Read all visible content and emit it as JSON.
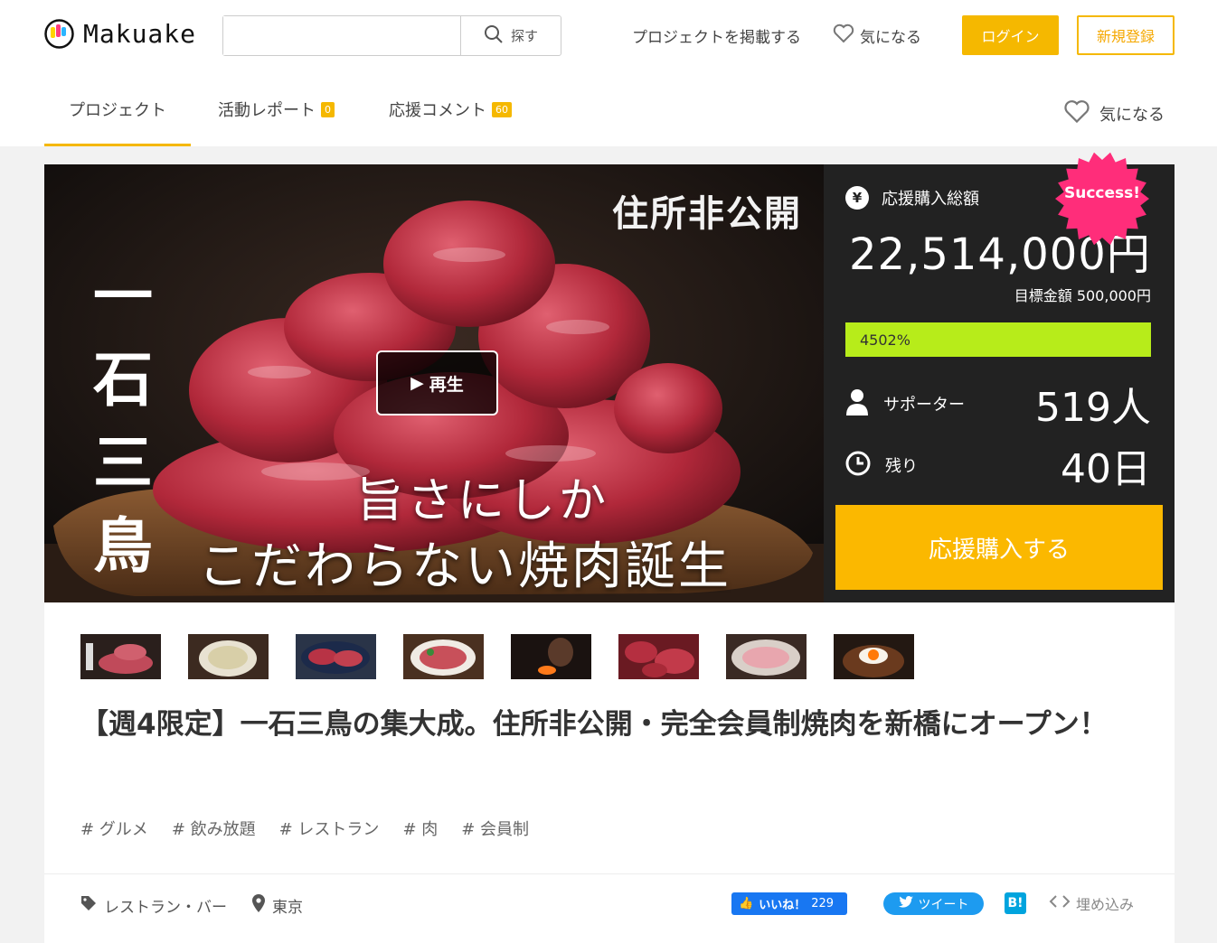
{
  "brand": {
    "name": "Makuake"
  },
  "search": {
    "placeholder": "",
    "button_label": "探す"
  },
  "nav": {
    "post_project": "プロジェクトを掲載する",
    "favorite": "気になる",
    "login": "ログイン",
    "signup": "新規登録"
  },
  "tabs": [
    {
      "label": "プロジェクト",
      "badge": null,
      "active": true
    },
    {
      "label": "活動レポート",
      "badge": "0",
      "active": false
    },
    {
      "label": "応援コメント",
      "badge": "60",
      "active": false
    }
  ],
  "tab_favorite": "気になる",
  "hero": {
    "tag": "住所非公開",
    "vertical_title": [
      "一",
      "石",
      "三",
      "鳥"
    ],
    "copy_line1": "旨さにしか",
    "copy_line2": "こだわらない焼肉誕生",
    "play_label": "再生"
  },
  "stats": {
    "total_label": "応援購入総額",
    "total_amount": "22,514,000円",
    "goal_text": "目標金額 500,000円",
    "progress_text": "4502%",
    "progress_fraction": 1.0,
    "supporters_label": "サポーター",
    "supporters_value": "519人",
    "remaining_label": "残り",
    "remaining_value": "40日",
    "cta_label": "応援購入する",
    "success_badge": "Success!"
  },
  "thumbnails": [
    {
      "name": "thumb-hero"
    },
    {
      "name": "thumb-rice"
    },
    {
      "name": "thumb-steak-plate"
    },
    {
      "name": "thumb-sliced-beef"
    },
    {
      "name": "thumb-chef-grill"
    },
    {
      "name": "thumb-meat-cuts"
    },
    {
      "name": "thumb-tongue"
    },
    {
      "name": "thumb-egg-bowl"
    }
  ],
  "project": {
    "title": "【週4限定】一石三鳥の集大成。住所非公開・完全会員制焼肉を新橋にオープン！",
    "tags": [
      "# グルメ",
      "# 飲み放題",
      "# レストラン",
      "# 肉",
      "# 会員制"
    ],
    "category": "レストラン・バー",
    "location": "東京"
  },
  "social": {
    "like_label": "いいね！",
    "like_count": "229",
    "tweet_label": "ツイート",
    "hatena_label": "B!",
    "embed_label": "埋め込み"
  },
  "colors": {
    "accent": "#f5b800",
    "progress": "#b7ec1a",
    "stats_bg": "#222222",
    "success": "#ff2d7a"
  }
}
